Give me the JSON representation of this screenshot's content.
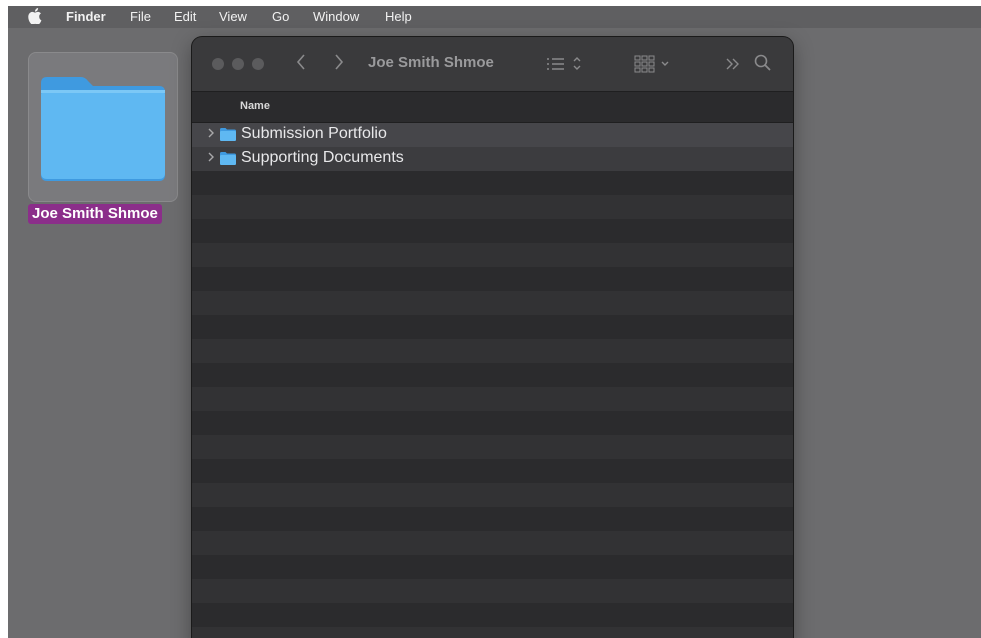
{
  "menubar": {
    "apple_icon": "apple-icon",
    "items": [
      "Finder",
      "File",
      "Edit",
      "View",
      "Go",
      "Window",
      "Help"
    ]
  },
  "desktop": {
    "folder_label": "Joe Smith Shmoe",
    "label_color": "#8b2e8a"
  },
  "finder": {
    "title": "Joe Smith Shmoe",
    "column_header": "Name",
    "rows": [
      {
        "label": "Submission Portfolio"
      },
      {
        "label": "Supporting Documents"
      }
    ]
  },
  "colors": {
    "folder_blue": "#58b4f0",
    "window_bg": "#2b2b2d",
    "row_selected": "#46464a"
  }
}
